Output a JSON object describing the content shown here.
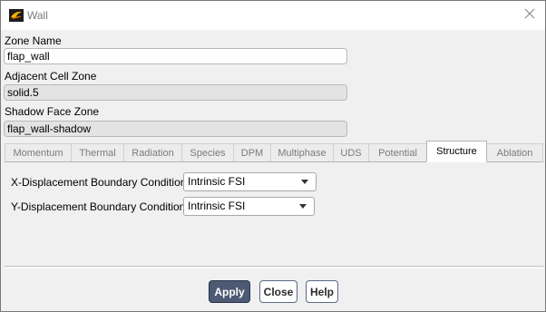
{
  "window": {
    "title": "Wall"
  },
  "zone_name": {
    "label": "Zone Name",
    "value": "flap_wall"
  },
  "adjacent_cell_zone": {
    "label": "Adjacent Cell Zone",
    "value": "solid.5"
  },
  "shadow_face_zone": {
    "label": "Shadow Face Zone",
    "value": "flap_wall-shadow"
  },
  "tabs": [
    {
      "label": "Momentum"
    },
    {
      "label": "Thermal"
    },
    {
      "label": "Radiation"
    },
    {
      "label": "Species"
    },
    {
      "label": "DPM"
    },
    {
      "label": "Multiphase"
    },
    {
      "label": "UDS"
    },
    {
      "label": "Potential"
    },
    {
      "label": "Structure",
      "active": true
    },
    {
      "label": "Ablation"
    }
  ],
  "structure": {
    "x_disp_label": "X-Displacement Boundary Condition",
    "x_disp_value": "Intrinsic FSI",
    "y_disp_label": "Y-Displacement Boundary Condition",
    "y_disp_value": "Intrinsic FSI"
  },
  "buttons": {
    "apply": "Apply",
    "close": "Close",
    "help": "Help"
  },
  "icons": {
    "app": "fluent-app-icon",
    "close": "close-icon",
    "dropdown": "chevron-down-icon"
  },
  "colors": {
    "primary_button": "#4d5a73",
    "active_tab": "#ffffff",
    "inactive_tab_text": "#7b7b7b"
  }
}
